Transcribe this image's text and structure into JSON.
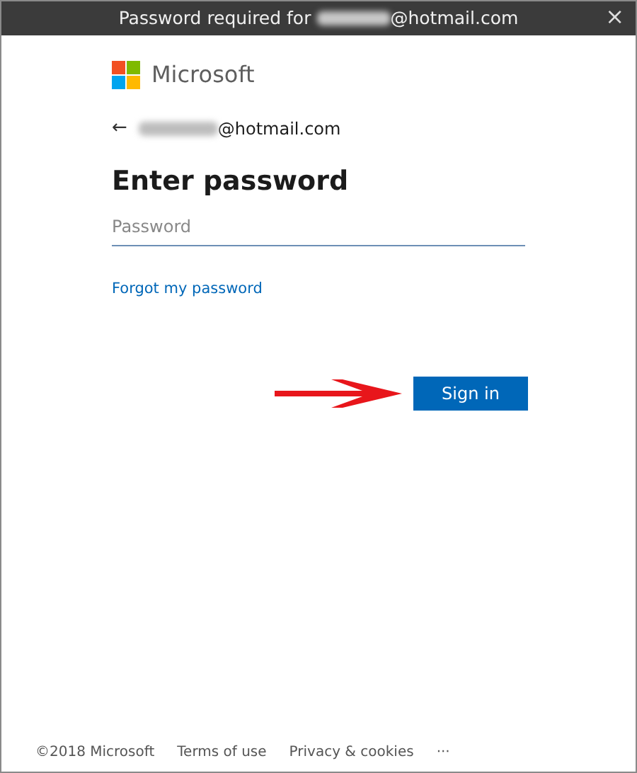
{
  "window": {
    "title_prefix": "Password required for",
    "title_suffix": "@hotmail.com",
    "close": "×"
  },
  "brand": "Microsoft",
  "account": {
    "back": "←",
    "email_suffix": "@hotmail.com"
  },
  "heading": "Enter password",
  "password": {
    "placeholder": "Password"
  },
  "forgot_link": "Forgot my password",
  "sign_in": "Sign in",
  "footer": [
    "©2018 Microsoft",
    "Terms of use",
    "Privacy & cookies",
    "···"
  ]
}
